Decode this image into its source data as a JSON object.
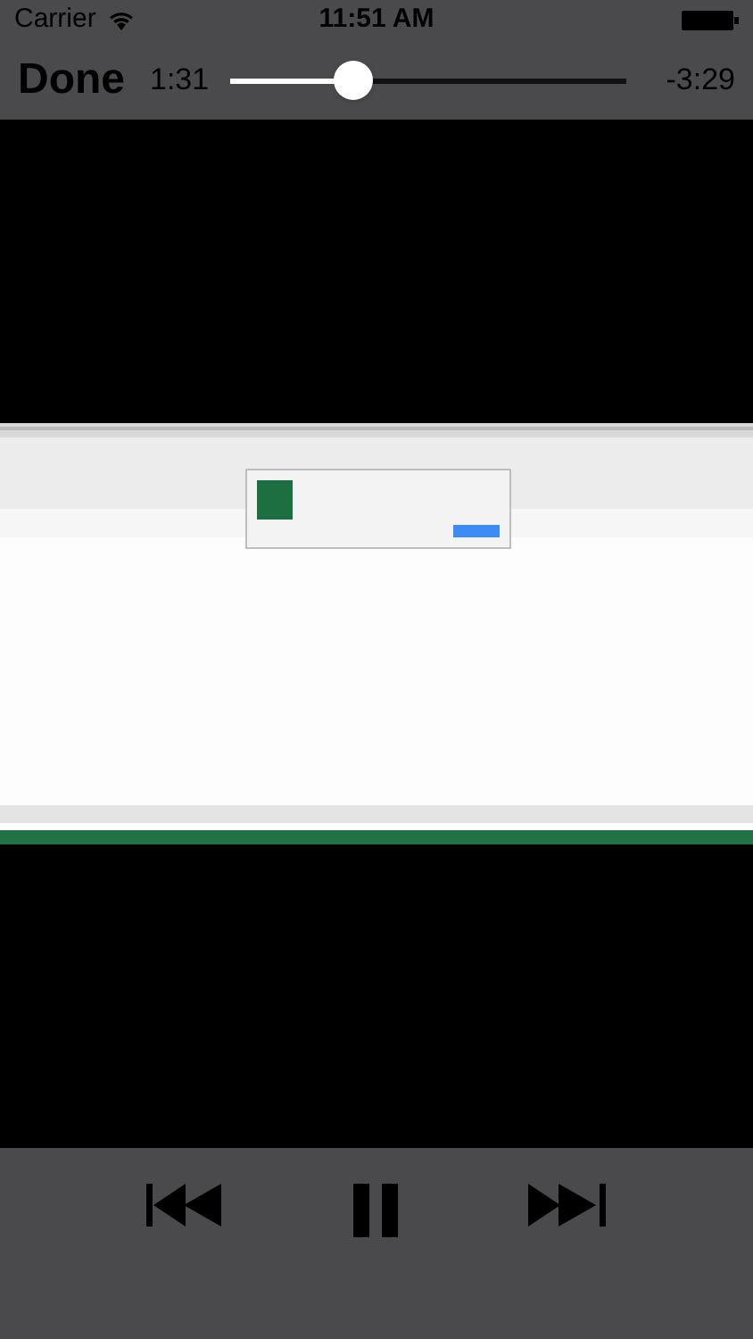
{
  "status_bar": {
    "carrier": "Carrier",
    "time": "11:51 AM"
  },
  "player_bar": {
    "done": "Done",
    "elapsed": "1:31",
    "remaining": "-3:29",
    "level": 0.31
  }
}
